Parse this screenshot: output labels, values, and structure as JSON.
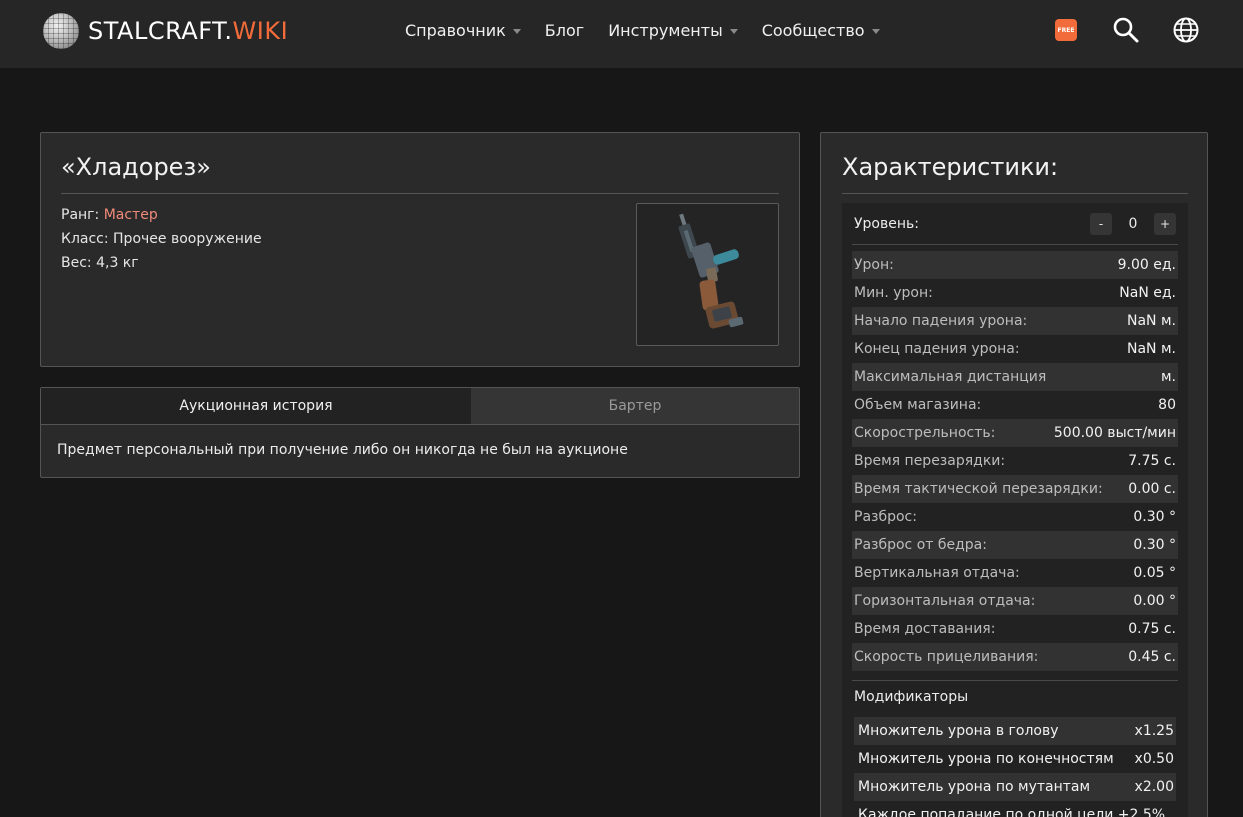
{
  "header": {
    "logo_main": "STALCRAFT.",
    "logo_accent": "WIKI",
    "nav": [
      {
        "label": "Справочник"
      },
      {
        "label": "Блог"
      },
      {
        "label": "Инструменты"
      },
      {
        "label": "Сообщество"
      }
    ],
    "free_badge": "FREE",
    "accent_color": "#f26b3a"
  },
  "item": {
    "title": "«Хладорез»",
    "rank_label": "Ранг:",
    "rank_value": "Мастер",
    "class_text": "Класс: Прочее вооружение",
    "weight_text": "Вес: 4,3 кг"
  },
  "tabs": {
    "auction": "Аукционная история",
    "barter": "Бартер",
    "content": "Предмет персональный при получение либо он никогда не был на аукционе"
  },
  "stats": {
    "title": "Характеристики:",
    "level_label": "Уровень:",
    "level_minus": "-",
    "level_value": "0",
    "level_plus": "+",
    "rows": [
      {
        "name": "Урон:",
        "value": "9.00 ед."
      },
      {
        "name": "Мин. урон:",
        "value": "NaN ед."
      },
      {
        "name": "Начало падения урона:",
        "value": "NaN м."
      },
      {
        "name": "Конец падения урона:",
        "value": "NaN м."
      },
      {
        "name": "Максимальная дистанция",
        "value": "м."
      },
      {
        "name": "Объем магазина:",
        "value": "80"
      },
      {
        "name": "Скорострельность:",
        "value": "500.00 выст/мин"
      },
      {
        "name": "Время перезарядки:",
        "value": "7.75 с."
      },
      {
        "name": "Время тактической перезарядки:",
        "value": "0.00 с."
      },
      {
        "name": "Разброс:",
        "value": "0.30 °"
      },
      {
        "name": "Разброс от бедра:",
        "value": "0.30 °"
      },
      {
        "name": "Вертикальная отдача:",
        "value": "0.05 °"
      },
      {
        "name": "Горизонтальная отдача:",
        "value": "0.00 °"
      },
      {
        "name": "Время доставания:",
        "value": "0.75 с."
      },
      {
        "name": "Скорость прицеливания:",
        "value": "0.45 с."
      }
    ],
    "modifiers_title": "Модификаторы",
    "modifiers": [
      {
        "name": "Множитель урона в голову",
        "value": "x1.25"
      },
      {
        "name": "Множитель урона по конечностям",
        "value": "x0.50"
      },
      {
        "name": "Множитель урона по мутантам",
        "value": "x2.00"
      },
      {
        "name": "Каждое попадание по одной цели +2.5%",
        "value": ""
      }
    ]
  }
}
